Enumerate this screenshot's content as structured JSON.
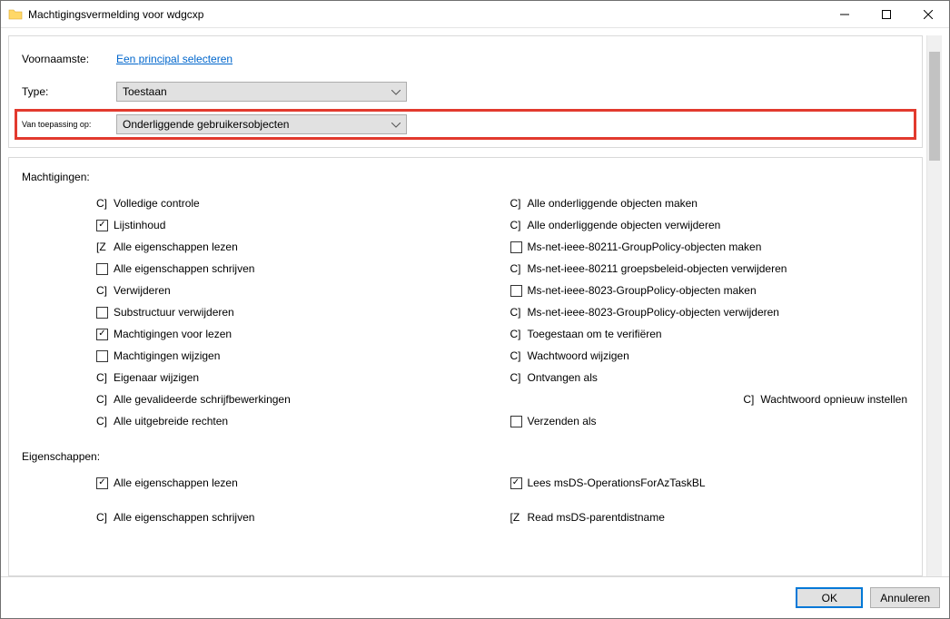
{
  "window": {
    "title": "Machtigingsvermelding voor wdgcxp"
  },
  "principal": {
    "label": "Voornaamste:",
    "value": "Een principal selecteren"
  },
  "type": {
    "label": "Type:",
    "value": "Toestaan"
  },
  "appliesTo": {
    "label": "Van toepassing op:",
    "value": "Onderliggende gebruikersobjecten"
  },
  "permissions": {
    "title": "Machtigingen:",
    "left": [
      {
        "kind": "gray",
        "prefix": "C]",
        "label": "Volledige controle"
      },
      {
        "kind": "check",
        "checked": true,
        "label": "Lijstinhoud"
      },
      {
        "kind": "gray",
        "prefix": "[Z",
        "label": "Alle eigenschappen lezen"
      },
      {
        "kind": "check",
        "checked": false,
        "label": "Alle eigenschappen schrijven"
      },
      {
        "kind": "gray",
        "prefix": "C]",
        "label": "Verwijderen"
      },
      {
        "kind": "check",
        "checked": false,
        "label": "Substructuur verwijderen"
      },
      {
        "kind": "check",
        "checked": true,
        "label": "Machtigingen voor lezen"
      },
      {
        "kind": "check",
        "checked": false,
        "label": "Machtigingen wijzigen"
      },
      {
        "kind": "gray",
        "prefix": "C]",
        "label": "Eigenaar wijzigen"
      },
      {
        "kind": "gray",
        "prefix": "C]",
        "label": "Alle gevalideerde schrijfbewerkingen"
      },
      {
        "kind": "gray",
        "prefix": "C]",
        "label": "Alle uitgebreide rechten"
      }
    ],
    "right": [
      {
        "kind": "gray",
        "prefix": "C]",
        "label": "Alle onderliggende objecten maken"
      },
      {
        "kind": "gray",
        "prefix": "C]",
        "label": "Alle onderliggende objecten verwijderen"
      },
      {
        "kind": "check",
        "checked": false,
        "label": "Ms-net-ieee-80211-GroupPolicy-objecten maken"
      },
      {
        "kind": "gray",
        "prefix": "C]",
        "label": "Ms-net-ieee-80211 groepsbeleid-objecten verwijderen"
      },
      {
        "kind": "check",
        "checked": false,
        "label": "Ms-net-ieee-8023-GroupPolicy-objecten maken"
      },
      {
        "kind": "gray",
        "prefix": "C]",
        "label": "Ms-net-ieee-8023-GroupPolicy-objecten verwijderen"
      },
      {
        "kind": "gray",
        "prefix": "C]",
        "label": "Toegestaan om te verifiëren"
      },
      {
        "kind": "gray",
        "prefix": "C]",
        "label": "Wachtwoord wijzigen"
      },
      {
        "kind": "gray",
        "prefix": "C]",
        "label": "Ontvangen als"
      },
      {
        "kind": "gray-right",
        "prefix": "C]",
        "label": "Wachtwoord opnieuw instellen"
      },
      {
        "kind": "check",
        "checked": false,
        "label": "Verzenden als"
      }
    ]
  },
  "properties": {
    "title": "Eigenschappen:",
    "left": [
      {
        "kind": "check",
        "checked": true,
        "label": "Alle eigenschappen lezen"
      },
      {
        "kind": "gray",
        "prefix": "C]",
        "label": "Alle eigenschappen schrijven"
      }
    ],
    "right": [
      {
        "kind": "check",
        "checked": true,
        "label": "Lees msDS-OperationsForAzTaskBL"
      },
      {
        "kind": "gray",
        "prefix": "[Z",
        "label": "Read msDS-parentdistname"
      }
    ]
  },
  "buttons": {
    "ok": "OK",
    "cancel": "Annuleren"
  }
}
